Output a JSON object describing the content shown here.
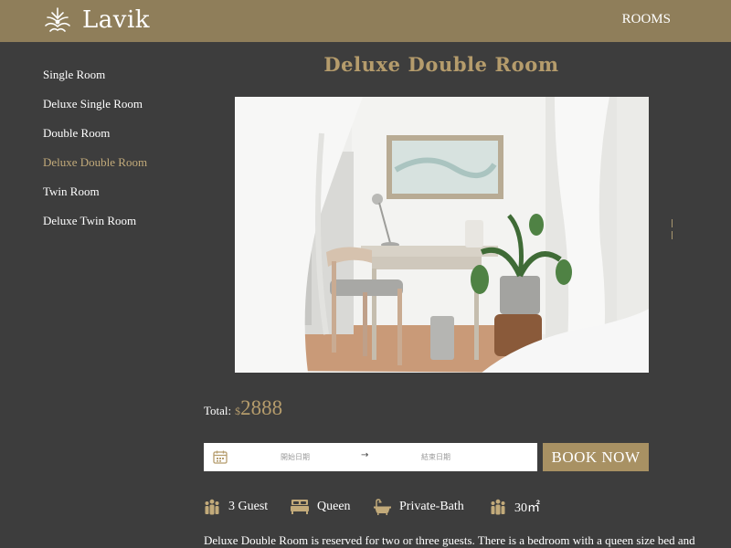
{
  "header": {
    "brand": "Lavik",
    "nav_rooms": "ROOMS"
  },
  "sidebar": {
    "items": [
      {
        "label": "Single Room"
      },
      {
        "label": "Deluxe Single Room"
      },
      {
        "label": "Double Room"
      },
      {
        "label": "Deluxe Double Room",
        "active": true
      },
      {
        "label": "Twin Room"
      },
      {
        "label": "Deluxe Twin Room"
      }
    ]
  },
  "room": {
    "title": "Deluxe Double Room",
    "photo_icon": "room-photo",
    "pager_dots": 2
  },
  "booking": {
    "total_label": "Total:",
    "currency": "$",
    "amount": "2888",
    "start_placeholder": "開始日期",
    "arrow": "→",
    "end_placeholder": "結束日期",
    "book_label": "BOOK NOW"
  },
  "amenities": [
    {
      "icon": "guests-icon",
      "label": "3 Guest"
    },
    {
      "icon": "bed-icon",
      "label": "Queen"
    },
    {
      "icon": "bath-icon",
      "label": "Private-Bath"
    },
    {
      "icon": "area-icon",
      "label": "30㎡"
    }
  ],
  "description": "Deluxe Double Room is reserved for two or three guests. There is a bedroom with a queen size bed and",
  "colors": {
    "header_bg": "#8f7e5a",
    "page_bg": "#3d3d3d",
    "accent": "#b59c6c",
    "button_bg": "#a89163"
  }
}
